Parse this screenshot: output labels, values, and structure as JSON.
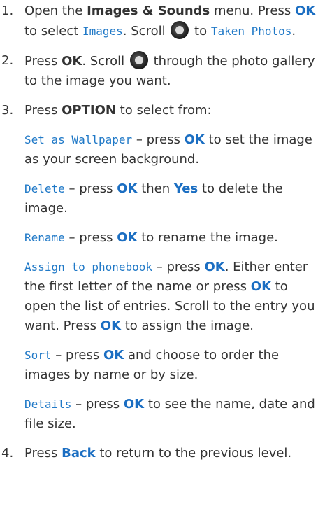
{
  "steps": [
    {
      "num": "1.",
      "parts": [
        "Open the ",
        "Images & Sounds",
        " menu. Press ",
        "OK",
        " to select ",
        "Images",
        ". Scroll ",
        " to ",
        "Taken Photos",
        "."
      ]
    },
    {
      "num": "2.",
      "parts": [
        "Press ",
        "OK",
        ". Scroll ",
        " through the photo gallery to the image you want."
      ]
    },
    {
      "num": "3.",
      "parts": [
        "Press ",
        "OPTION",
        " to select from:"
      ]
    },
    {
      "num": "4.",
      "parts": [
        "Press ",
        "Back",
        " to return to the previous level."
      ]
    }
  ],
  "options": [
    {
      "name": "Set as Wallpaper",
      "parts": [
        " – press ",
        "OK",
        " to set the image as your screen background."
      ]
    },
    {
      "name": "Delete",
      "parts": [
        " – press ",
        "OK",
        " then ",
        "Yes",
        " to delete the image."
      ]
    },
    {
      "name": "Rename",
      "parts": [
        " – press ",
        "OK",
        " to rename the image."
      ]
    },
    {
      "name": "Assign to phonebook",
      "parts": [
        " – press ",
        "OK",
        ". Either enter the first letter of the name or press ",
        "OK",
        " to open the list of entries. Scroll to the entry you want. Press ",
        "OK",
        " to assign the image."
      ]
    },
    {
      "name": "Sort",
      "parts": [
        " – press ",
        "OK",
        " and choose to order the images by name or by size."
      ]
    },
    {
      "name": "Details",
      "parts": [
        " – press ",
        "OK",
        " to see the name, date and file size."
      ]
    }
  ],
  "icons": {
    "nav": "navigation-key-icon"
  },
  "colors": {
    "text": "#333333",
    "key": "#1b6ec2",
    "screen_text": "#2079c7"
  }
}
